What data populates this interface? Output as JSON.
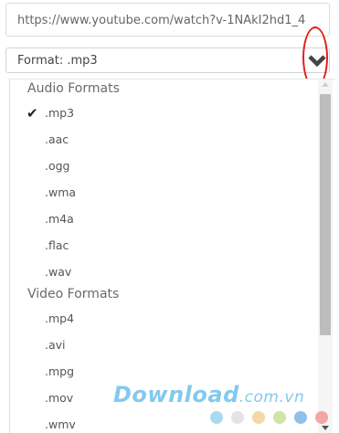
{
  "url_field": {
    "value": "https://www.youtube.com/watch?v-1NAkI2hd1_4"
  },
  "format_select": {
    "label": "Format",
    "value": ".mp3"
  },
  "dropdown": {
    "groups": [
      {
        "label": "Audio Formats",
        "options": [
          ".mp3",
          ".aac",
          ".ogg",
          ".wma",
          ".m4a",
          ".flac",
          ".wav"
        ]
      },
      {
        "label": "Video Formats",
        "options": [
          ".mp4",
          ".avi",
          ".mpg",
          ".mov",
          ".wmv"
        ]
      }
    ],
    "selected": ".mp3"
  },
  "watermark": {
    "text": "Download",
    "suffix": ".com.vn"
  },
  "colors": {
    "annotation_ring": "#e0201b",
    "watermark": "#1e9de0",
    "dots": [
      "#a9daf2",
      "#e4e4e4",
      "#f3d8a8",
      "#cde6a6",
      "#8fc1e8",
      "#f2a7a7"
    ]
  }
}
